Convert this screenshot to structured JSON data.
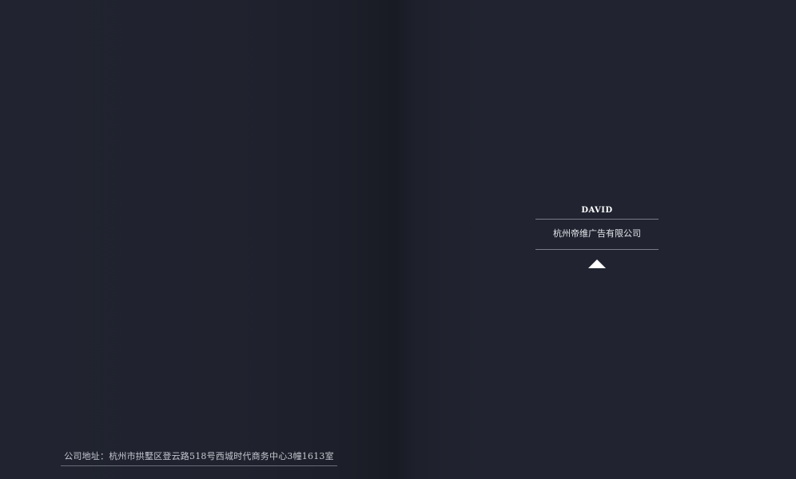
{
  "left_page": {
    "address": "公司地址：杭州市拱墅区登云路518号西城时代商务中心3幢1613室"
  },
  "right_page": {
    "name": "DAVID",
    "company": "杭州帝维广告有限公司",
    "icon": "triangle-up-icon"
  },
  "colors": {
    "background": "#212430",
    "text_light": "#e4e5ea",
    "rule": "#7b7e88"
  }
}
